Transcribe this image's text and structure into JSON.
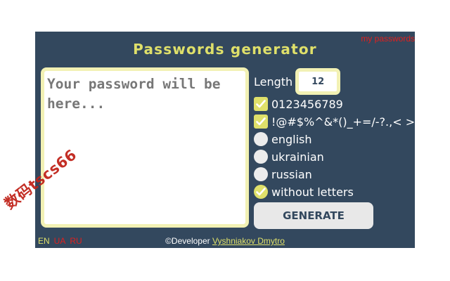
{
  "app": {
    "title": "Passwords generator",
    "my_passwords_link": "my passwords"
  },
  "password": {
    "placeholder": "Your password will be here...",
    "value": ""
  },
  "length": {
    "label": "Length",
    "value": "12"
  },
  "options": [
    {
      "label": "0123456789",
      "type": "checkbox",
      "checked": true
    },
    {
      "label": "!@#$%^&*()_+=/-?.,< >",
      "type": "checkbox",
      "checked": true
    },
    {
      "label": "english",
      "type": "radio",
      "checked": false
    },
    {
      "label": "ukrainian",
      "type": "radio",
      "checked": false
    },
    {
      "label": "russian",
      "type": "radio",
      "checked": false
    },
    {
      "label": "without letters",
      "type": "radio",
      "checked": true
    }
  ],
  "generate_label": "GENERATE",
  "languages": [
    {
      "code": "EN",
      "active": true
    },
    {
      "code": "UA",
      "active": false
    },
    {
      "code": "RU",
      "active": false
    }
  ],
  "footer": {
    "prefix": "©Developer ",
    "developer_name": "Vyshniakov Dmytro"
  },
  "watermark": "数码tscs66",
  "colors": {
    "panel_bg": "#33485e",
    "accent_yellow": "#dfe06a",
    "link_red": "#e0201e",
    "input_border": "#f2f1b4"
  },
  "icons": {
    "checkbox_checked": "check-icon",
    "radio_checked": "check-icon"
  }
}
